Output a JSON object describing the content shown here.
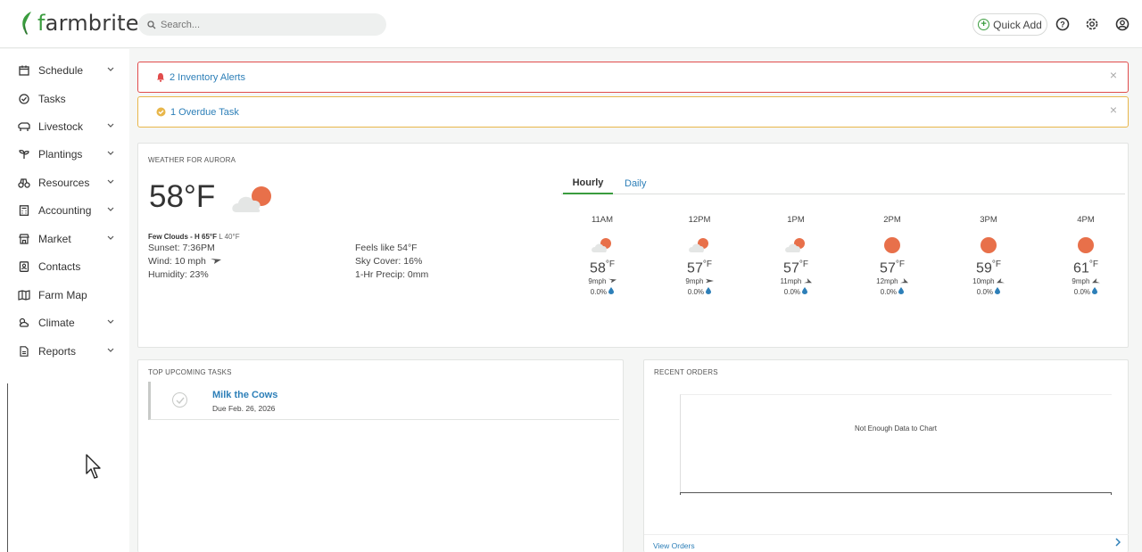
{
  "header": {
    "logo_text_start": "f",
    "logo_text": "farmbrite",
    "search_placeholder": "Search...",
    "quick_add_label": "Quick Add",
    "icons": [
      "help-icon",
      "settings-icon",
      "user-icon"
    ]
  },
  "sidebar": {
    "items": [
      {
        "label": "Schedule",
        "icon": "calendar-icon",
        "expandable": true
      },
      {
        "label": "Tasks",
        "icon": "check-circle-icon",
        "expandable": false
      },
      {
        "label": "Livestock",
        "icon": "livestock-icon",
        "expandable": true
      },
      {
        "label": "Plantings",
        "icon": "sprout-icon",
        "expandable": true
      },
      {
        "label": "Resources",
        "icon": "resources-icon",
        "expandable": true
      },
      {
        "label": "Accounting",
        "icon": "calculator-icon",
        "expandable": true
      },
      {
        "label": "Market",
        "icon": "market-icon",
        "expandable": true
      },
      {
        "label": "Contacts",
        "icon": "contacts-icon",
        "expandable": false
      },
      {
        "label": "Farm Map",
        "icon": "map-icon",
        "expandable": false
      },
      {
        "label": "Climate",
        "icon": "climate-icon",
        "expandable": true
      },
      {
        "label": "Reports",
        "icon": "report-icon",
        "expandable": true
      }
    ]
  },
  "alerts": {
    "inventory": "2 Inventory Alerts",
    "overdue": "1 Overdue Task"
  },
  "weather": {
    "title": "WEATHER FOR AURORA",
    "temp": "58°F",
    "conditions": "Few Clouds - H 65°F",
    "low": "L 40°F",
    "sunset": "Sunset: 7:36PM",
    "wind": "Wind: 10 mph",
    "humidity": "Humidity: 23%",
    "feels_like": "Feels like 54°F",
    "sky_cover": "Sky Cover: 16%",
    "precip": "1-Hr Precip: 0mm",
    "tabs": {
      "hourly": "Hourly",
      "daily": "Daily"
    },
    "hourly": [
      {
        "time": "11AM",
        "temp": "58",
        "unit": "°F",
        "wind": "9mph",
        "precip": "0.0%",
        "icon": "partly-cloudy-icon"
      },
      {
        "time": "12PM",
        "temp": "57",
        "unit": "°F",
        "wind": "9mph",
        "precip": "0.0%",
        "icon": "partly-cloudy-icon"
      },
      {
        "time": "1PM",
        "temp": "57",
        "unit": "°F",
        "wind": "11mph",
        "precip": "0.0%",
        "icon": "partly-cloudy-icon"
      },
      {
        "time": "2PM",
        "temp": "57",
        "unit": "°F",
        "wind": "12mph",
        "precip": "0.0%",
        "icon": "sun-icon"
      },
      {
        "time": "3PM",
        "temp": "59",
        "unit": "°F",
        "wind": "10mph",
        "precip": "0.0%",
        "icon": "sun-icon"
      },
      {
        "time": "4PM",
        "temp": "61",
        "unit": "°F",
        "wind": "9mph",
        "precip": "0.0%",
        "icon": "sun-icon"
      }
    ]
  },
  "tasks": {
    "title": "TOP UPCOMING TASKS",
    "items": [
      {
        "name": "Milk the Cows",
        "due": "Due Feb. 26, 2026"
      }
    ]
  },
  "orders": {
    "title": "RECENT ORDERS",
    "empty_message": "Not Enough Data to Chart",
    "view_link": "View Orders"
  },
  "colors": {
    "brand_green": "#3a9c3e",
    "link_blue": "#2d7fb8",
    "alert_red": "#e14c4c",
    "alert_yellow": "#e8b64a",
    "sun_orange": "#e8704a"
  }
}
